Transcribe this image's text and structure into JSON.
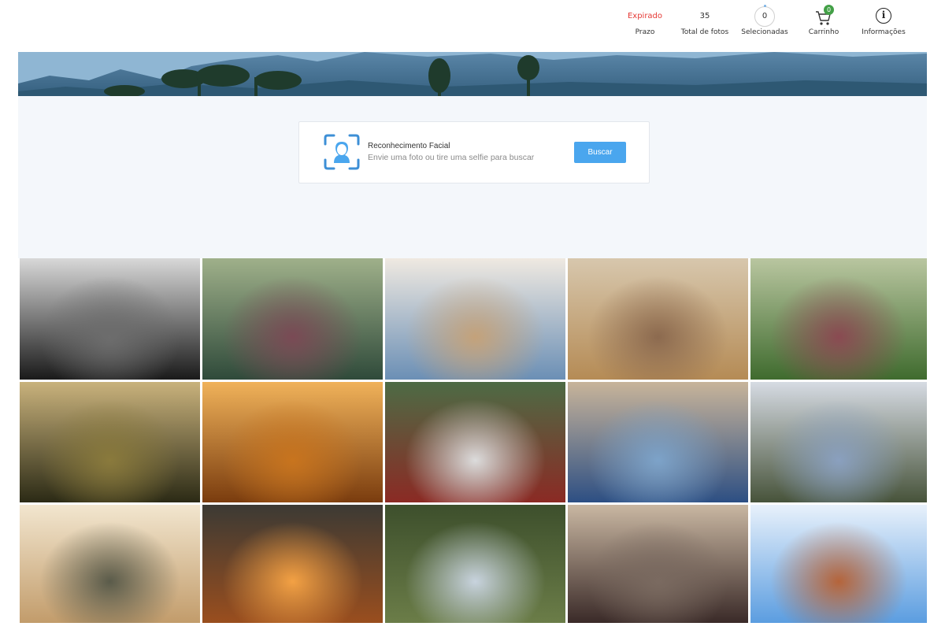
{
  "header": {
    "prazo": {
      "value": "Expirado",
      "label": "Prazo"
    },
    "total_fotos": {
      "value": "35",
      "label": "Total de fotos"
    },
    "selecionadas": {
      "value": "0",
      "label": "Selecionadas"
    },
    "carrinho": {
      "badge": "0",
      "label": "Carrinho",
      "icon": "cart-icon"
    },
    "informacoes": {
      "label": "Informações",
      "icon": "info-icon",
      "glyph": "i"
    }
  },
  "face_recognition": {
    "title": "Reconhecimento Facial",
    "subtitle": "Envie uma foto ou tire uma selfie para buscar",
    "button_label": "Buscar",
    "icon": "face-scan-icon"
  },
  "colors": {
    "accent": "#4aa6ee",
    "expired": "#e53935",
    "badge": "#43a047",
    "page_bg": "#f4f7fb"
  },
  "gallery": {
    "photos": [
      {
        "name": "photo-1"
      },
      {
        "name": "photo-2"
      },
      {
        "name": "photo-3"
      },
      {
        "name": "photo-4"
      },
      {
        "name": "photo-5"
      },
      {
        "name": "photo-6"
      },
      {
        "name": "photo-7"
      },
      {
        "name": "photo-8"
      },
      {
        "name": "photo-9"
      },
      {
        "name": "photo-10"
      },
      {
        "name": "photo-11"
      },
      {
        "name": "photo-12"
      },
      {
        "name": "photo-13"
      },
      {
        "name": "photo-14"
      },
      {
        "name": "photo-15"
      }
    ]
  }
}
